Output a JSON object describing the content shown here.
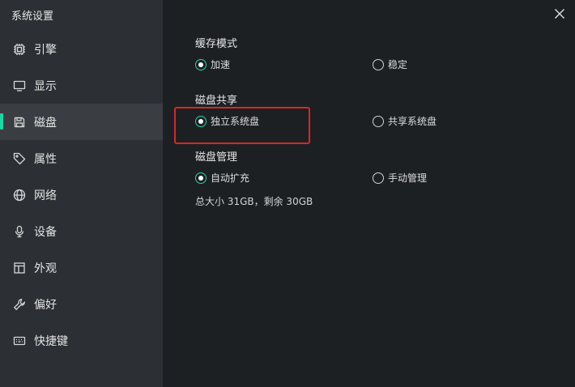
{
  "window": {
    "title": "系统设置"
  },
  "sidebar": {
    "items": [
      {
        "label": "引擎",
        "icon": "chip-icon"
      },
      {
        "label": "显示",
        "icon": "monitor-icon"
      },
      {
        "label": "磁盘",
        "icon": "disk-icon",
        "active": true
      },
      {
        "label": "属性",
        "icon": "tag-icon"
      },
      {
        "label": "网络",
        "icon": "globe-icon"
      },
      {
        "label": "设备",
        "icon": "microphone-icon"
      },
      {
        "label": "外观",
        "icon": "window-icon"
      },
      {
        "label": "偏好",
        "icon": "wrench-icon"
      },
      {
        "label": "快捷键",
        "icon": "keyboard-icon"
      }
    ]
  },
  "cache_mode": {
    "title": "缓存模式",
    "options": [
      {
        "label": "加速",
        "checked": true
      },
      {
        "label": "稳定",
        "checked": false
      }
    ]
  },
  "disk_share": {
    "title": "磁盘共享",
    "options": [
      {
        "label": "独立系统盘",
        "checked": true
      },
      {
        "label": "共享系统盘",
        "checked": false
      }
    ]
  },
  "disk_management": {
    "title": "磁盘管理",
    "options": [
      {
        "label": "自动扩充",
        "checked": true
      },
      {
        "label": "手动管理",
        "checked": false
      }
    ],
    "info": "总大小 31GB，剩余 30GB"
  },
  "colors": {
    "accent": "#1ed6a4",
    "sidebar_bg": "#2c2f33",
    "content_bg": "#1d2023",
    "highlight": "#d62828"
  }
}
